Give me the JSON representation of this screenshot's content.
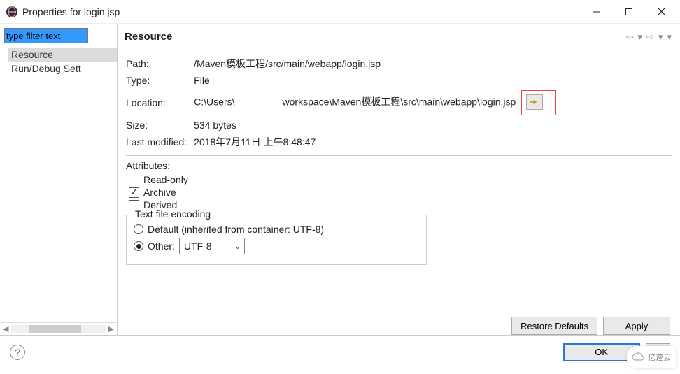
{
  "window": {
    "title": "Properties for login.jsp"
  },
  "sidebar": {
    "filter_placeholder": "type filter text",
    "items": [
      {
        "label": "Resource",
        "selected": true
      },
      {
        "label": "Run/Debug Sett",
        "selected": false
      }
    ]
  },
  "header": {
    "title": "Resource"
  },
  "resource": {
    "path_label": "Path:",
    "path_value": "/Maven模板工程/src/main/webapp/login.jsp",
    "type_label": "Type:",
    "type_value": "File",
    "location_label": "Location:",
    "location_prefix": "C:\\Users\\",
    "location_suffix": "workspace\\Maven模板工程\\src\\main\\webapp\\login.jsp",
    "size_label": "Size:",
    "size_value": "534  bytes",
    "modified_label": "Last modified:",
    "modified_value": "2018年7月11日 上午8:48:47"
  },
  "attributes": {
    "label": "Attributes:",
    "readonly": {
      "label": "Read-only",
      "checked": false
    },
    "archive": {
      "label": "Archive",
      "checked": true
    },
    "derived": {
      "label": "Derived",
      "checked": false
    }
  },
  "encoding": {
    "legend": "Text file encoding",
    "default_label": "Default (inherited from container: UTF-8)",
    "other_label": "Other:",
    "other_value": "UTF-8",
    "selected": "other"
  },
  "buttons": {
    "restore": "Restore Defaults",
    "apply": "Apply",
    "ok": "OK",
    "cancel": "C"
  },
  "watermark": "亿速云"
}
